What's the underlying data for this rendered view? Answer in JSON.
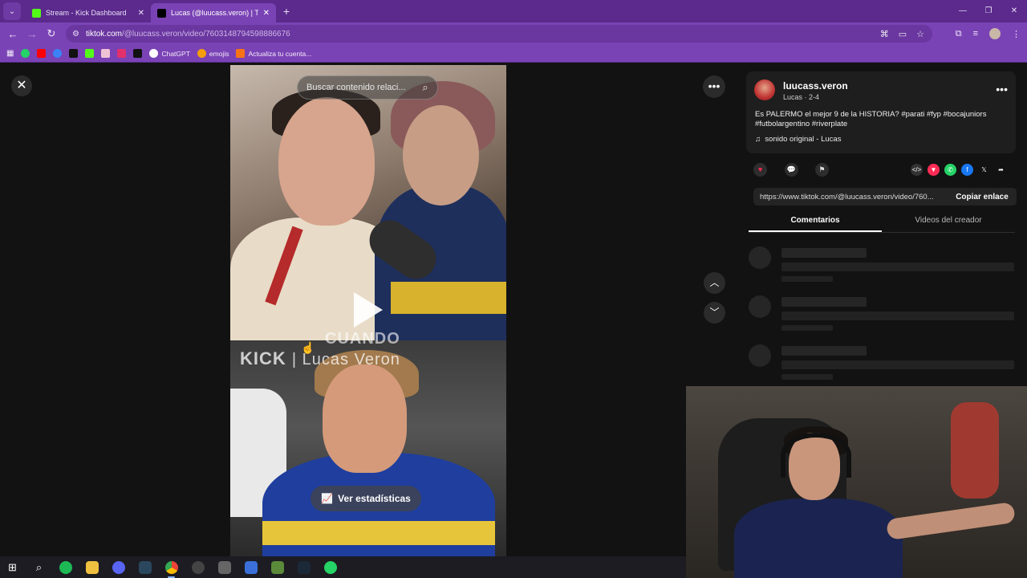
{
  "browser": {
    "tabs": [
      {
        "title": "Stream - Kick Dashboard",
        "favicon_color": "#53fc18",
        "active": false
      },
      {
        "title": "Lucas (@luucass.veron) | TikTok",
        "favicon_color": "#000000",
        "active": true
      }
    ],
    "address": {
      "host": "tiktok.com",
      "path": "/@luucass.veron/video/7603148794598886676"
    },
    "bookmarks": [
      {
        "label": "",
        "color": "#25d366"
      },
      {
        "label": "",
        "color": "#ff0000"
      },
      {
        "label": "",
        "color": "#3b82f6"
      },
      {
        "label": "",
        "color": "#111111"
      },
      {
        "label": "",
        "color": "#53fc18"
      },
      {
        "label": "",
        "color": "#f0c3d4"
      },
      {
        "label": "",
        "color": "#e1306c"
      },
      {
        "label": "",
        "color": "#111111"
      },
      {
        "label": "ChatGPT",
        "color": "#ffffff"
      },
      {
        "label": "emojis",
        "color": "#f59e0b"
      },
      {
        "label": "Actualiza tu cuenta...",
        "color": "#f97316"
      }
    ]
  },
  "video": {
    "search_placeholder": "Buscar contenido relaci...",
    "overlay_kick": "KICK",
    "overlay_name": "| Lucas Veron",
    "overlay_caption": "CUANDO",
    "stats_button": "Ver estadísticas"
  },
  "post": {
    "username": "luucass.veron",
    "subline": "Lucas · 2-4",
    "description": "Es PALERMO el mejor 9 de la HISTORIA? #parati #fyp #bocajuniors #futbolargentino #riverplate",
    "sound": "sonido original - Lucas",
    "link": "https://www.tiktok.com/@luucass.veron/video/760...",
    "copy_label": "Copiar enlace",
    "tabs": [
      "Comentarios",
      "Videos del creador"
    ]
  },
  "taskbar": [
    {
      "name": "windows-start-icon",
      "glyph": "⊞",
      "color": ""
    },
    {
      "name": "search-icon",
      "glyph": "⌕",
      "color": ""
    },
    {
      "name": "spotify-icon",
      "glyph": "",
      "color": "#1db954"
    },
    {
      "name": "file-explorer-icon",
      "glyph": "",
      "color": "#f0c040"
    },
    {
      "name": "discord-icon",
      "glyph": "",
      "color": "#5865f2"
    },
    {
      "name": "steam-icon",
      "glyph": "",
      "color": "#1b2838"
    },
    {
      "name": "chrome-icon",
      "glyph": "",
      "color": "#e8453c"
    },
    {
      "name": "obs-icon",
      "glyph": "",
      "color": "#444444"
    },
    {
      "name": "app-icon",
      "glyph": "",
      "color": "#666666"
    },
    {
      "name": "app-blue-icon",
      "glyph": "",
      "color": "#3b6fd9"
    },
    {
      "name": "minecraft-icon",
      "glyph": "",
      "color": "#5a8a3a"
    },
    {
      "name": "steam-2-icon",
      "glyph": "",
      "color": "#2a475e"
    },
    {
      "name": "whatsapp-icon",
      "glyph": "",
      "color": "#25d366"
    }
  ]
}
